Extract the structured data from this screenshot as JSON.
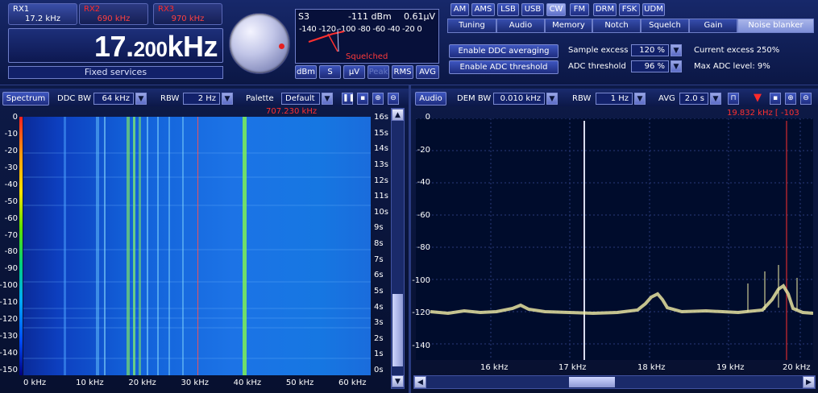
{
  "rx_tabs": [
    {
      "name": "RX1",
      "freq": "17.2 kHz",
      "active": true
    },
    {
      "name": "RX2",
      "freq": "690 kHz",
      "active": false
    },
    {
      "name": "RX3",
      "freq": "970 kHz",
      "active": false
    }
  ],
  "frequency": {
    "big": "17.",
    "small": "200",
    "unit": "kHz"
  },
  "service": "Fixed services",
  "meter": {
    "s_level": "S3",
    "dbm": "-111 dBm",
    "uv": "0.61µV",
    "scale": "-140 -120 -100 -80 -60 -40 -20  0",
    "squelch": "Squelched",
    "buttons": [
      "dBm",
      "S",
      "µV",
      "Peak",
      "RMS",
      "AVG"
    ]
  },
  "modes": [
    "AM",
    "AMS",
    "LSB",
    "USB",
    "CW",
    "FM",
    "DRM",
    "FSK",
    "UDM"
  ],
  "active_mode": "CW",
  "tabs": [
    "Tuning",
    "Audio",
    "Memory",
    "Notch",
    "Squelch",
    "Gain",
    "Noise blanker"
  ],
  "active_tab": "Noise blanker",
  "noise_blanker": {
    "btn_ddc": "Enable DDC averaging",
    "btn_adc": "Enable ADC threshold",
    "sample_excess_label": "Sample excess",
    "sample_excess_value": "120 %",
    "adc_threshold_label": "ADC threshold",
    "adc_threshold_value": "96 %",
    "current_excess": "Current excess 250%",
    "max_adc": "Max ADC level: 9%"
  },
  "spectrum_panel": {
    "title": "Spectrum",
    "ddc_bw_label": "DDC BW",
    "ddc_bw_value": "64 kHz",
    "rbw_label": "RBW",
    "rbw_value": "2 Hz",
    "palette_label": "Palette",
    "palette_value": "Default",
    "cursor_freq": "707.230 kHz",
    "db_ticks": [
      "0",
      "-10",
      "-20",
      "-30",
      "-40",
      "-50",
      "-60",
      "-70",
      "-80",
      "-90",
      "-100",
      "-110",
      "-120",
      "-130",
      "-140",
      "-150"
    ],
    "time_ticks": [
      "16s",
      "15s",
      "14s",
      "13s",
      "12s",
      "11s",
      "10s",
      "9s",
      "8s",
      "7s",
      "6s",
      "5s",
      "4s",
      "3s",
      "2s",
      "1s",
      "0s"
    ],
    "freq_ticks": [
      "0 kHz",
      "10 kHz",
      "20 kHz",
      "30 kHz",
      "40 kHz",
      "50 kHz",
      "60 kHz"
    ]
  },
  "audio_panel": {
    "title": "Audio",
    "dem_bw_label": "DEM BW",
    "dem_bw_value": "0.010 kHz",
    "rbw_label": "RBW",
    "rbw_value": "1 Hz",
    "avg_label": "AVG",
    "avg_value": "2.0 s",
    "marker": "19.832 kHz [ -103 dBm]",
    "y_ticks": [
      "0",
      "-20",
      "-40",
      "-60",
      "-80",
      "-100",
      "-120",
      "-140"
    ],
    "x_ticks": [
      "16 kHz",
      "17 kHz",
      "18 kHz",
      "19 kHz",
      "20 kHz"
    ]
  },
  "colors": {
    "background": "#0a1438",
    "accent": "#3e56c0",
    "marker": "#ff3030",
    "trace": "#f5f0a8"
  }
}
